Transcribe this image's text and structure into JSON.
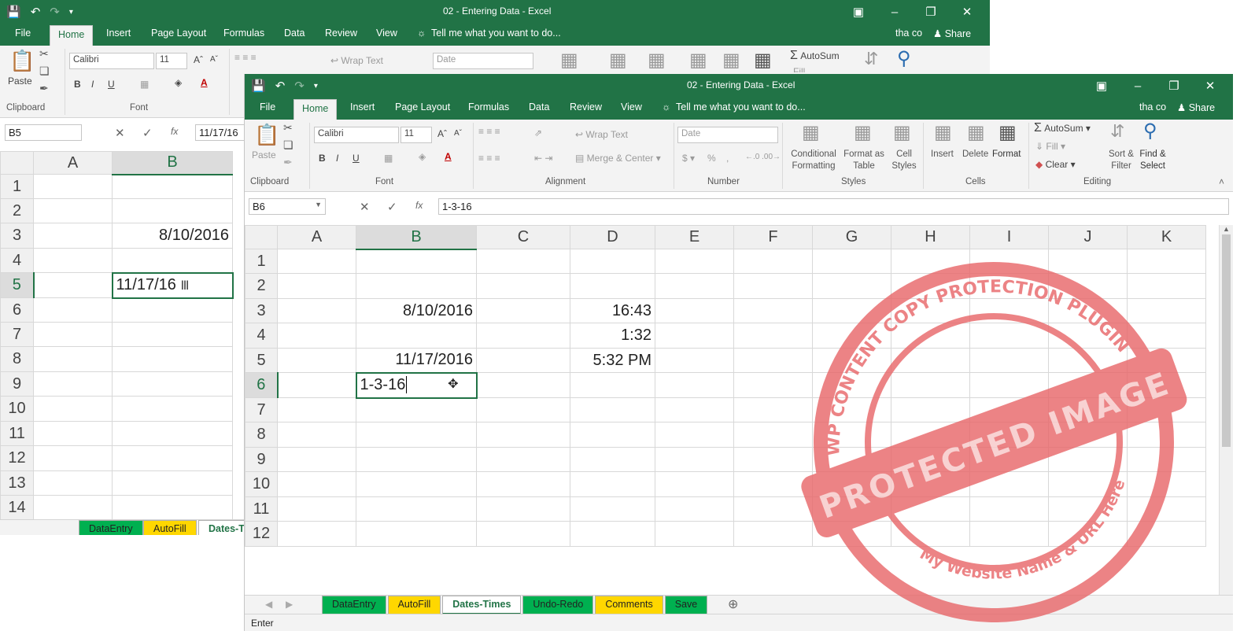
{
  "back": {
    "title": "02 - Entering Data - Excel",
    "tabs": [
      "File",
      "Home",
      "Insert",
      "Page Layout",
      "Formulas",
      "Data",
      "Review",
      "View"
    ],
    "tell_me": "Tell me what you want to do...",
    "user": "tha co",
    "share": "Share",
    "font_name": "Calibri",
    "font_size": "11",
    "number_format": "Date",
    "wrap_text": "Wrap Text",
    "autosum": "AutoSum",
    "fill": "Fill",
    "paste": "Paste",
    "clipboard": "Clipboard",
    "font_group": "Font",
    "name_box": "B5",
    "formula": "11/17/16",
    "columns": [
      "A",
      "B"
    ],
    "rows": [
      "1",
      "2",
      "3",
      "4",
      "5",
      "6",
      "7",
      "8",
      "9",
      "10",
      "11",
      "12",
      "13",
      "14"
    ],
    "b3": "8/10/2016",
    "b5": "11/17/16",
    "sheet_tabs": [
      "DataEntry",
      "AutoFill",
      "Dates-T"
    ]
  },
  "front": {
    "title": "02 - Entering Data - Excel",
    "tabs": [
      "File",
      "Home",
      "Insert",
      "Page Layout",
      "Formulas",
      "Data",
      "Review",
      "View"
    ],
    "tell_me": "Tell me what you want to do...",
    "user": "tha co",
    "share": "Share",
    "ribbon": {
      "paste": "Paste",
      "font_name": "Calibri",
      "font_size": "11",
      "wrap_text": "Wrap Text",
      "merge_center": "Merge & Center",
      "number_format": "Date",
      "conditional_formatting": "Conditional Formatting",
      "format_as_table": "Format as Table",
      "cell_styles": "Cell Styles",
      "insert": "Insert",
      "delete": "Delete",
      "format": "Format",
      "autosum": "AutoSum",
      "fill": "Fill",
      "clear": "Clear",
      "sort_filter": "Sort & Filter",
      "find_select": "Find & Select",
      "groups": [
        "Clipboard",
        "Font",
        "Alignment",
        "Number",
        "Styles",
        "Cells",
        "Editing"
      ]
    },
    "name_box": "B6",
    "formula": "1-3-16",
    "columns": [
      "A",
      "B",
      "C",
      "D",
      "E",
      "F",
      "G",
      "H",
      "I",
      "J",
      "K"
    ],
    "rows": [
      "1",
      "2",
      "3",
      "4",
      "5",
      "6",
      "7",
      "8",
      "9",
      "10",
      "11",
      "12"
    ],
    "cells": {
      "b3": "8/10/2016",
      "b5": "11/17/2016",
      "b6": "1-3-16",
      "d3": "16:43",
      "d4": "1:32",
      "d5": "5:32 PM"
    },
    "sheet_tabs": [
      {
        "label": "DataEntry",
        "color": "#00b050"
      },
      {
        "label": "AutoFill",
        "color": "#ffd700"
      },
      {
        "label": "Dates-Times",
        "color": "#ffffff"
      },
      {
        "label": "Undo-Redo",
        "color": "#00b050"
      },
      {
        "label": "Comments",
        "color": "#ffd700"
      },
      {
        "label": "Save",
        "color": "#00b050"
      }
    ],
    "status": "Enter"
  },
  "watermark": {
    "text_top": "WP CONTENT COPY PROTECTION PLUGIN",
    "text_band": "PROTECTED IMAGE",
    "text_bottom": "My Website Name & URL Here",
    "color": "#e8696b"
  },
  "colors": {
    "excel_green": "#217346",
    "tab_green": "#00b050",
    "tab_yellow": "#ffd700"
  }
}
